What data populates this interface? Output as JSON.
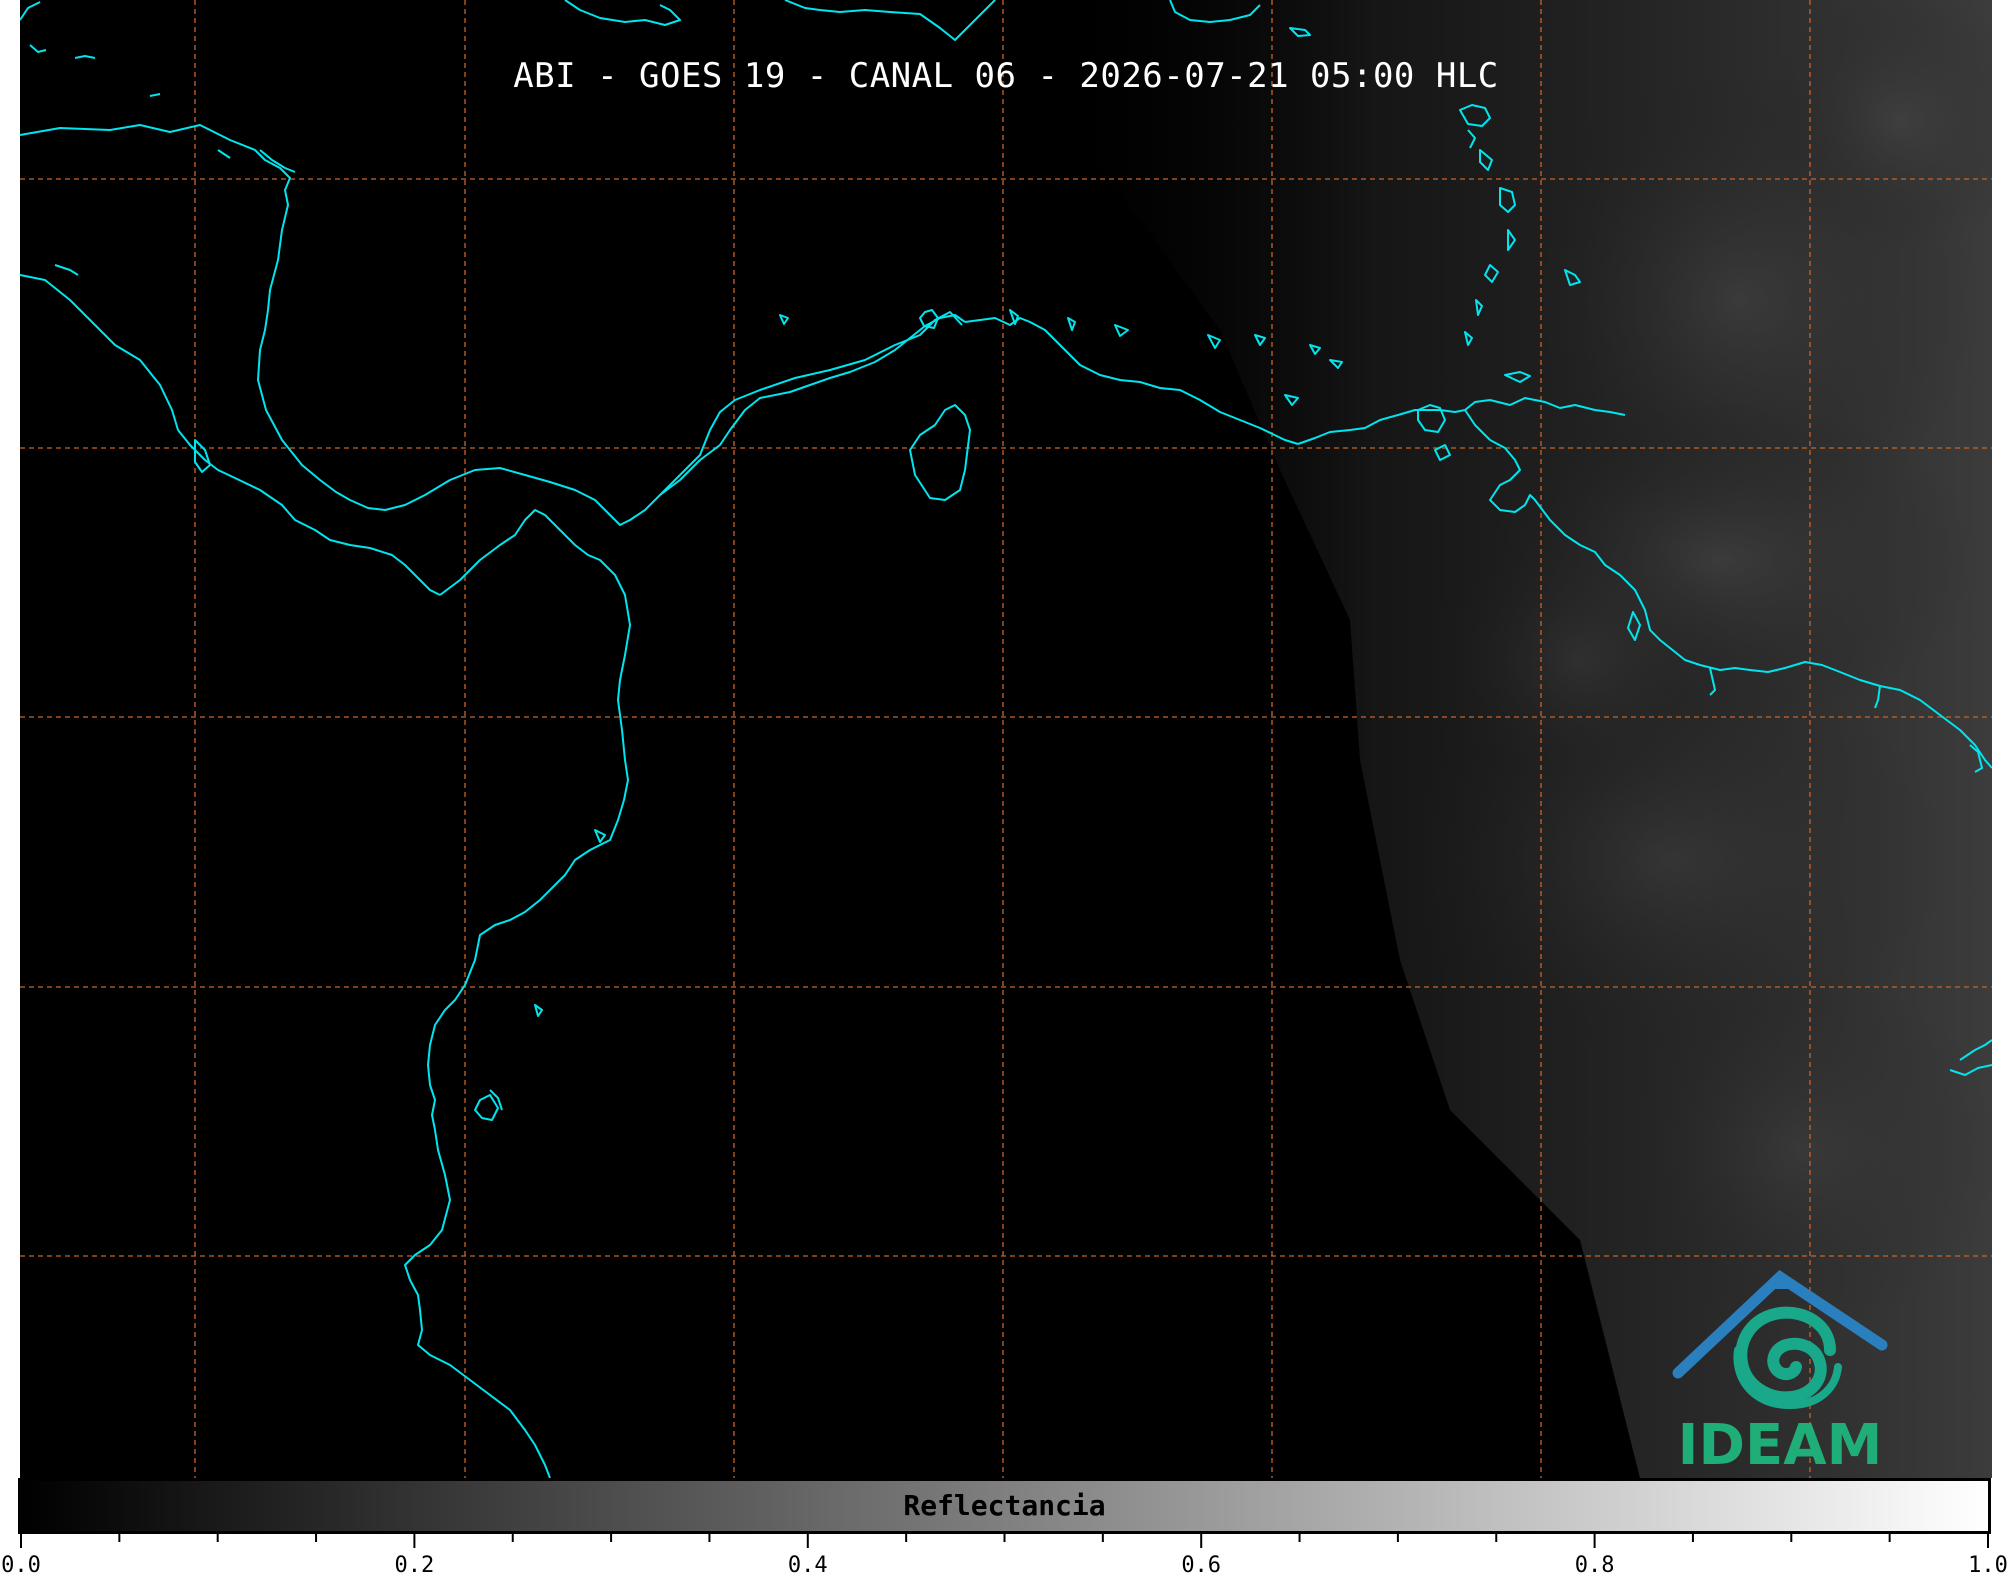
{
  "title": "ABI - GOES 19 - CANAL 06 - 2026-07-21 05:00 HLC",
  "colorbar": {
    "label": "Reflectancia",
    "range": [
      0.0,
      1.0
    ],
    "major_ticks": [
      "0.0",
      "0.2",
      "0.4",
      "0.6",
      "0.8",
      "1.0"
    ],
    "minor_tick_step": 0.05,
    "colormap": "grayscale"
  },
  "logo": {
    "text": "IDEAM",
    "text_color": "#1fae78",
    "roof_color": "#2a7fbf",
    "swirl_color": "#1aa88a"
  },
  "colors": {
    "background": "#000000",
    "coastline": "#00e5ee",
    "gridline": "#c8642a",
    "title_text": "#ffffff"
  },
  "map": {
    "gridlines": "dashed",
    "coastlines": true
  }
}
